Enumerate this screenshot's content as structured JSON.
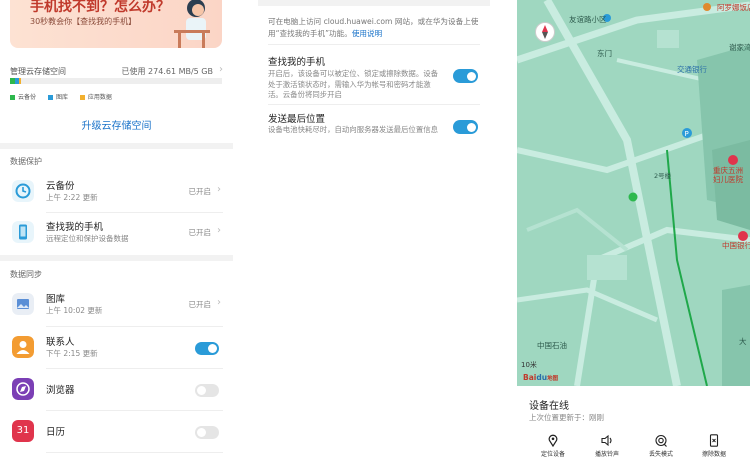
{
  "left_panel": {
    "banner": {
      "title": "手机找不到？怎么办？",
      "subtitle": "30秒教会你【查找我的手机】"
    },
    "storage": {
      "label": "管理云存储空间",
      "value": "已使用 274.61 MB/5 GB",
      "used_fraction": 0.054,
      "legend": [
        {
          "name": "云备份",
          "color": "#2db84d"
        },
        {
          "name": "图库",
          "color": "#2a9bd8"
        },
        {
          "name": "应用数据",
          "color": "#f2b02e"
        }
      ]
    },
    "upgrade_label": "升级云存储空间",
    "section_protection": "数据保护",
    "section_sync": "数据同步",
    "protection_items": [
      {
        "title": "云备份",
        "subtitle": "上午 2:22 更新",
        "status": "已开启"
      },
      {
        "title": "查找我的手机",
        "subtitle": "远程定位和保护设备数据",
        "status": "已开启"
      }
    ],
    "sync_items": [
      {
        "title": "图库",
        "subtitle": "上午 10:02 更新",
        "status": "已开启"
      },
      {
        "title": "联系人",
        "subtitle": "下午 2:15 更新",
        "toggle": "on"
      },
      {
        "title": "浏览器",
        "toggle": "off"
      },
      {
        "title": "日历",
        "toggle": "off",
        "icon_text": "31"
      }
    ]
  },
  "middle_panel": {
    "intro_text": "可在电脑上访问 cloud.huawei.com 网站，或在华为设备上使用“查找我的手机”功能。",
    "intro_link": "使用说明",
    "settings": [
      {
        "title": "查找我的手机",
        "description": "开启后，该设备可以被定位、锁定或擦除数据。设备处于激活锁状态时，需输入华为帐号和密码才能激活。云备份将同步开启",
        "toggle": "on"
      },
      {
        "title": "发送最后位置",
        "description": "设备电池快耗尽时，自动向服务器发送最后位置信息",
        "toggle": "on"
      }
    ]
  },
  "right_panel": {
    "map_labels": {
      "a": "友谊路小区",
      "b": "东门",
      "c": "交通银行",
      "d": "阿罗娜饭店",
      "e": "谢家湾",
      "f": "重庆五洲妇儿医院",
      "g": "中国银行",
      "h": "中国石油",
      "i": "2号楼",
      "j": "大"
    },
    "scale": "10米",
    "map_brand": {
      "a": "Bai",
      "b": "du",
      "c": "地图"
    },
    "status_title": "设备在线",
    "status_sub": "上次位置更新于：刚刚",
    "actions": [
      {
        "label": "定位设备",
        "icon": "location-pin-icon"
      },
      {
        "label": "播放铃声",
        "icon": "speaker-icon"
      },
      {
        "label": "丢失模式",
        "icon": "lost-mode-icon"
      },
      {
        "label": "擦除数据",
        "icon": "erase-phone-icon"
      }
    ]
  },
  "colors": {
    "accent": "#1a73c9",
    "toggle_on": "#2a9bd8",
    "map_bg": "#9fd7c0",
    "route": "#1fa84a"
  }
}
